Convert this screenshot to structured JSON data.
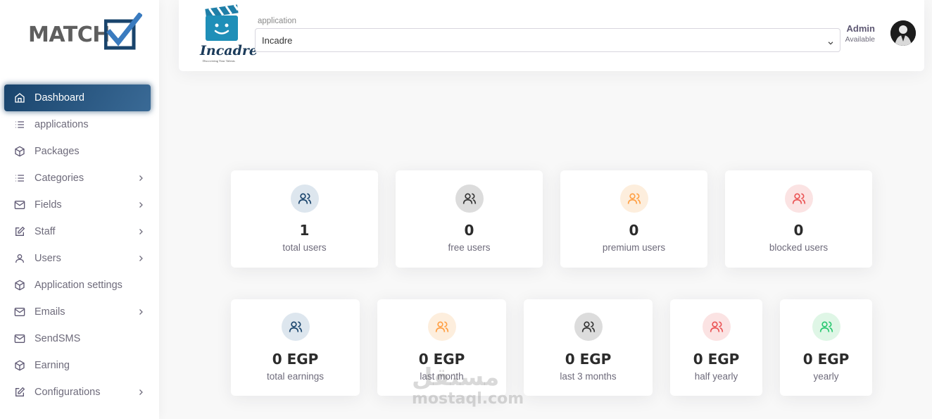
{
  "brand": {
    "logo_text": "MATCH"
  },
  "sidebar": {
    "items": [
      {
        "label": "Dashboard",
        "icon": "home-icon",
        "active": true,
        "chevron": false
      },
      {
        "label": "applications",
        "icon": "list-icon",
        "chevron": false
      },
      {
        "label": "Packages",
        "icon": "package-icon",
        "chevron": false
      },
      {
        "label": "Categories",
        "icon": "list-icon",
        "chevron": true
      },
      {
        "label": "Fields",
        "icon": "mail-icon",
        "chevron": true
      },
      {
        "label": "Staff",
        "icon": "edit-icon",
        "chevron": true
      },
      {
        "label": "Users",
        "icon": "user-icon",
        "chevron": true
      },
      {
        "label": "Application settings",
        "icon": "package-icon",
        "chevron": false
      },
      {
        "label": "Emails",
        "icon": "mail-icon",
        "chevron": true
      },
      {
        "label": "SendSMS",
        "icon": "mail-icon",
        "chevron": false
      },
      {
        "label": "Earning",
        "icon": "package-icon",
        "chevron": false
      },
      {
        "label": "Configurations",
        "icon": "edit-icon",
        "chevron": true
      }
    ]
  },
  "header": {
    "app_logo_text": "Incadre",
    "app_logo_tagline": "Discovering Your Talents",
    "select_label": "application",
    "select_value": "Incadre",
    "user_name": "Admin",
    "user_status": "Available"
  },
  "stats_users": [
    {
      "value": "1",
      "label": "total users",
      "color": "blue"
    },
    {
      "value": "0",
      "label": "free users",
      "color": "gray"
    },
    {
      "value": "0",
      "label": "premium users",
      "color": "orange"
    },
    {
      "value": "0",
      "label": "blocked users",
      "color": "red"
    }
  ],
  "stats_earnings": [
    {
      "value": "0 EGP",
      "label": "total earnings",
      "color": "blue"
    },
    {
      "value": "0 EGP",
      "label": "last month",
      "color": "orange"
    },
    {
      "value": "0 EGP",
      "label": "last 3 months",
      "color": "gray"
    },
    {
      "value": "0 EGP",
      "label": "half yearly",
      "color": "red"
    },
    {
      "value": "0 EGP",
      "label": "yearly",
      "color": "green"
    }
  ],
  "watermark": {
    "arabic": "مستقل",
    "latin": "mostaql.com"
  },
  "colors": {
    "primary": "#19446c",
    "orange": "#ff9f43",
    "red": "#ea5455",
    "green": "#28c76f"
  }
}
